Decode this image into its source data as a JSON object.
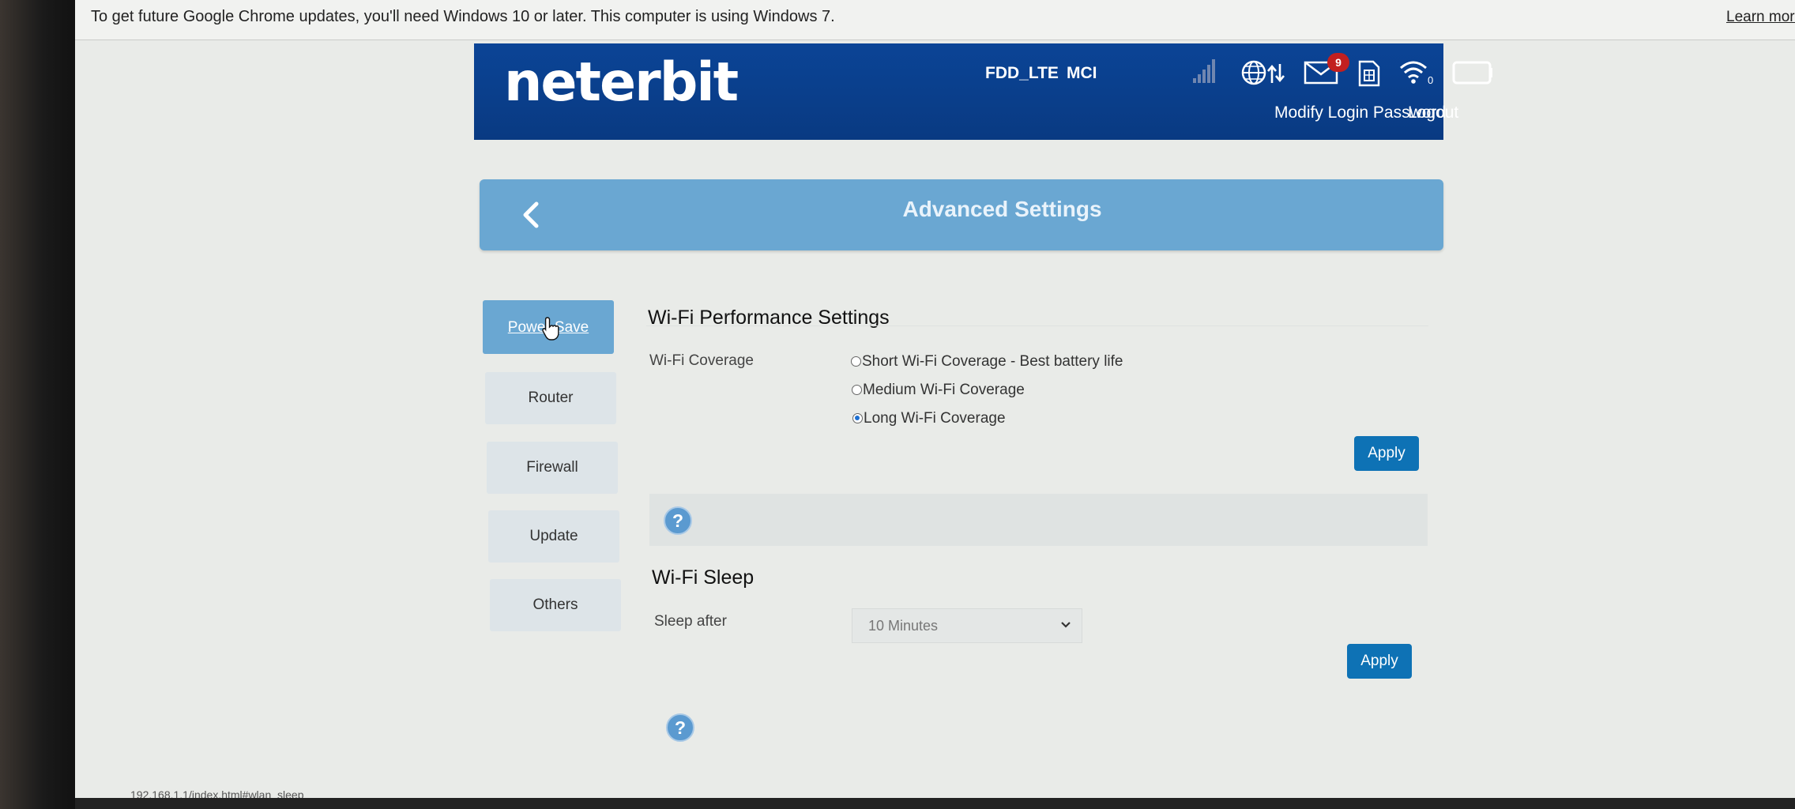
{
  "chrome": {
    "infobar_message": "To get future Google Chrome updates, you'll need Windows 10 or later. This computer is using Windows 7.",
    "learn_more": "Learn more",
    "status_url": "192.168.1.1/index.html#wlan_sleep"
  },
  "header": {
    "logo": "neterbit",
    "network_type": "FDD_LTE",
    "operator": "MCI",
    "unread_messages": "9",
    "wifi_clients": "0",
    "modify_password": "Modify Login Password",
    "logout": "Logout",
    "colors": {
      "header_bg": "#0b4496",
      "badge": "#c21f1f"
    }
  },
  "banner": {
    "title": "Advanced Settings"
  },
  "nav": {
    "items": [
      "Power Save",
      "Router",
      "Firewall",
      "Update",
      "Others"
    ],
    "active": "Power Save"
  },
  "wifi_performance": {
    "title": "Wi-Fi Performance Settings",
    "coverage_label": "Wi-Fi Coverage",
    "options": [
      "Short Wi-Fi Coverage - Best battery life",
      "Medium Wi-Fi Coverage",
      "Long Wi-Fi Coverage"
    ],
    "selected": "Long Wi-Fi Coverage",
    "apply": "Apply"
  },
  "wifi_sleep": {
    "title": "Wi-Fi Sleep",
    "sleep_label": "Sleep after",
    "sleep_value": "10 Minutes",
    "apply": "Apply"
  },
  "help": {
    "symbol": "?"
  },
  "colors": {
    "accent": "#6aa7d2",
    "button": "#0e72b5"
  }
}
